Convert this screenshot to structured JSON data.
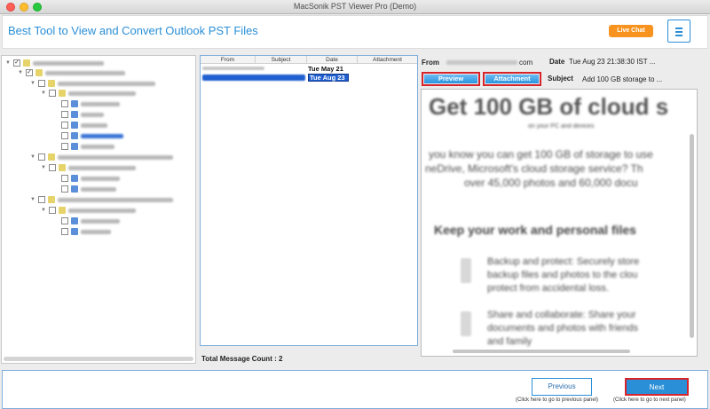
{
  "window": {
    "title": "MacSonik PST Viewer Pro (Demo)"
  },
  "header": {
    "brand": "Best Tool to View and Convert Outlook PST Files",
    "live_chat": "Live Chat"
  },
  "message_list": {
    "columns": [
      "From",
      "Subject",
      "Date",
      "Attachment"
    ],
    "rows": [
      {
        "date": "Tue May 21",
        "selected": false
      },
      {
        "date": "Tue Aug 23",
        "selected": true
      }
    ],
    "total_label": "Total Message Count : 2"
  },
  "detail": {
    "from_label": "From",
    "from_tail": "com",
    "date_label": "Date",
    "date_value": "Tue Aug 23 21:38:30 IST ...",
    "subject_label": "Subject",
    "subject_value": "Add 100 GB storage to ...",
    "preview_button": "Preview",
    "attachment_button": "Attachment"
  },
  "preview": {
    "headline": "Get 100 GB of cloud s",
    "sub": "on your PC and devices",
    "para1": "you know you can get 100 GB of storage to use",
    "para2": "neDrive, Microsoft's cloud storage service? Th",
    "para3": "over 45,000 photos and 60,000 docu",
    "section": "Keep your work and personal files",
    "b1a": "Backup and protect: Securely store",
    "b1b": "backup files and photos to the clou",
    "b1c": "protect from accidental loss.",
    "b2a": "Share and collaborate: Share your",
    "b2b": "documents and photos with friends",
    "b2c": "and family"
  },
  "footer": {
    "previous_label": "Previous",
    "next_label": "Next",
    "previous_hint": "(Click here to go to previous panel)",
    "next_hint": "(Click here to go to next panel)"
  },
  "colors": {
    "accent": "#2a8fd6",
    "live_chat": "#f7931e",
    "highlight_border": "#d6242a",
    "selection": "#1f5fd0"
  }
}
